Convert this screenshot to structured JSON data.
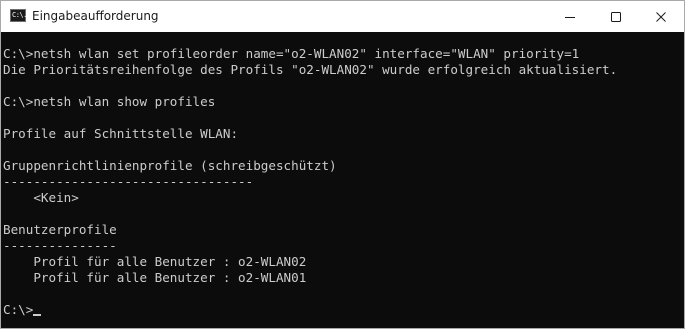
{
  "window": {
    "title": "Eingabeaufforderung",
    "app_icon_text": "C:\\."
  },
  "controls": {
    "minimize": "minimize",
    "maximize": "maximize",
    "close": "close"
  },
  "console": {
    "lines": [
      "C:\\>netsh wlan set profileorder name=\"o2-WLAN02\" interface=\"WLAN\" priority=1",
      "Die Prioritätsreihenfolge des Profils \"o2-WLAN02\" wurde erfolgreich aktualisiert.",
      "",
      "C:\\>netsh wlan show profiles",
      "",
      "Profile auf Schnittstelle WLAN:",
      "",
      "Gruppenrichtlinienprofile (schreibgeschützt)",
      "---------------------------------",
      "    <Kein>",
      "",
      "Benutzerprofile",
      "---------------",
      "    Profil für alle Benutzer : o2-WLAN02",
      "    Profil für alle Benutzer : o2-WLAN01",
      ""
    ],
    "prompt": "C:\\>"
  }
}
